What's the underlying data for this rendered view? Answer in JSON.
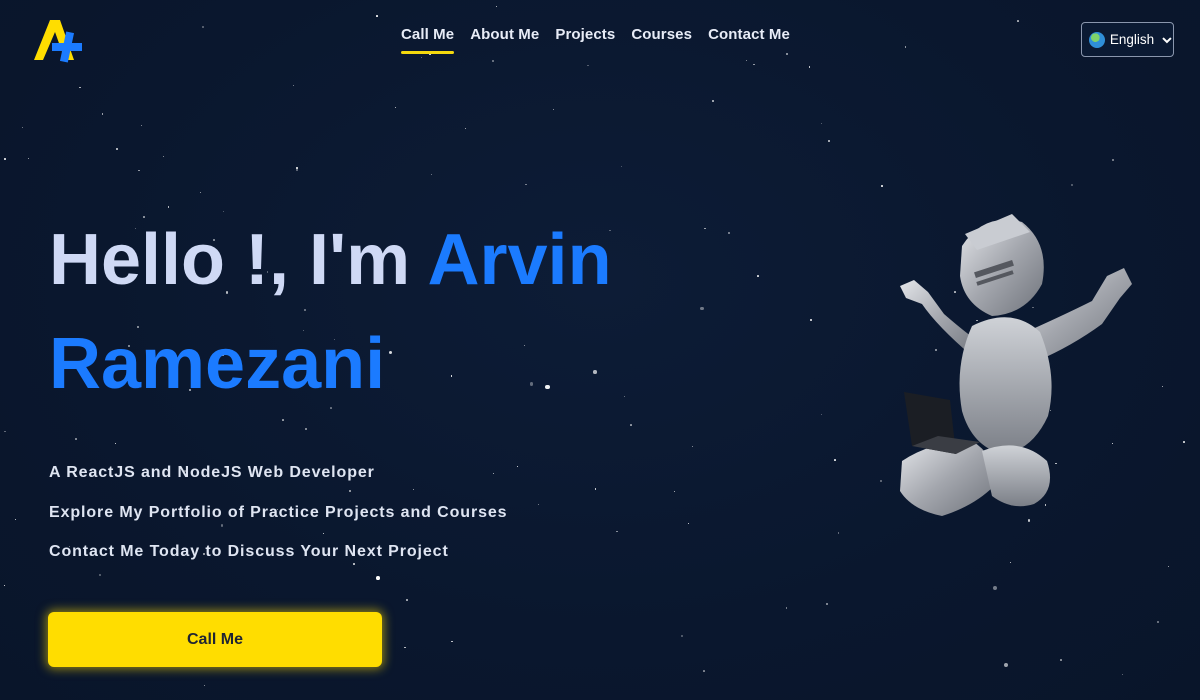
{
  "nav": {
    "items": [
      {
        "label": "Call Me",
        "active": true
      },
      {
        "label": "About Me",
        "active": false
      },
      {
        "label": "Projects",
        "active": false
      },
      {
        "label": "Courses",
        "active": false
      },
      {
        "label": "Contact Me",
        "active": false
      }
    ]
  },
  "language": {
    "label": "English",
    "icon": "globe-icon"
  },
  "hero": {
    "greeting": "Hello !, I'm ",
    "first_name": "Arvin",
    "last_name": "Ramezani",
    "taglines": [
      "A ReactJS and NodeJS Web Developer",
      "Explore My Portfolio of Practice Projects and Courses",
      "Contact Me Today to Discuss Your Next Project"
    ],
    "cta_label": "Call Me"
  },
  "colors": {
    "background": "#0b1830",
    "accent_yellow": "#ffdd00",
    "accent_blue": "#1b7bff",
    "title_text": "#cfd9f5"
  }
}
